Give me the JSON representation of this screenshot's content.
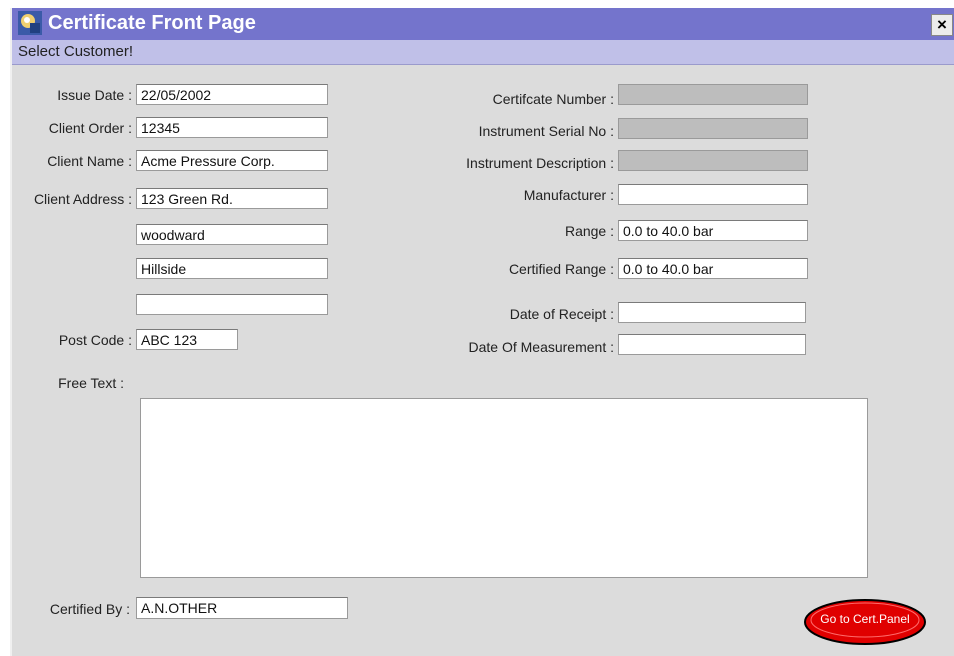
{
  "window": {
    "title": "Certificate Front Page",
    "close_label": "×",
    "icon": "app-icon"
  },
  "toolbar": {
    "select_customer": "Select Customer!"
  },
  "left": {
    "issue_date": {
      "label": "Issue Date :",
      "value": "22/05/2002"
    },
    "client_order": {
      "label": "Client Order :",
      "value": "12345"
    },
    "client_name": {
      "label": "Client Name :",
      "value": "Acme Pressure Corp."
    },
    "client_address": {
      "label": "Client Address :",
      "lines": [
        "123 Green Rd.",
        "woodward",
        "Hillside",
        ""
      ]
    },
    "post_code": {
      "label": "Post Code :",
      "value": "ABC 123"
    }
  },
  "right": {
    "certificate_number": {
      "label": "Certifcate Number :",
      "value": ""
    },
    "instrument_serial": {
      "label": "Instrument Serial No :",
      "value": ""
    },
    "instrument_description": {
      "label": "Instrument Description :",
      "value": ""
    },
    "manufacturer": {
      "label": "Manufacturer :",
      "value": ""
    },
    "range": {
      "label": "Range :",
      "value": "0.0 to 40.0 bar"
    },
    "certified_range": {
      "label": "Certified Range :",
      "value": "0.0 to 40.0 bar"
    },
    "date_of_receipt": {
      "label": "Date of Receipt :",
      "value": ""
    },
    "date_of_measurement": {
      "label": "Date Of Measurement :",
      "value": ""
    }
  },
  "free_text": {
    "label": "Free Text :",
    "value": ""
  },
  "certified_by": {
    "label": "Certified By :",
    "value": "A.N.OTHER"
  },
  "go_button": {
    "label": "Go to Cert.Panel",
    "color": "#e00000"
  },
  "colors": {
    "titlebar": "#7474cc",
    "subbar": "#c0c0e8",
    "readonly_field": "#bdbdbd"
  }
}
